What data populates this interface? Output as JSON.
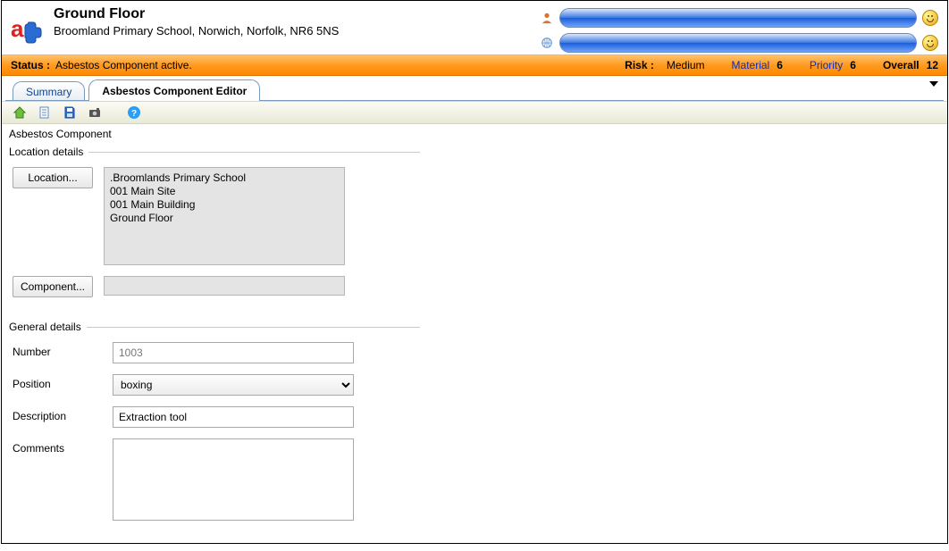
{
  "header": {
    "title": "Ground Floor",
    "subtitle": "Broomland Primary School, Norwich, Norfolk, NR6 5NS"
  },
  "status": {
    "label": "Status :",
    "text": "Asbestos Component active.",
    "risk_label": "Risk :",
    "risk_value": "Medium",
    "material_label": "Material",
    "material_value": "6",
    "priority_label": "Priority",
    "priority_value": "6",
    "overall_label": "Overall",
    "overall_value": "12"
  },
  "tabs": {
    "summary": "Summary",
    "editor": "Asbestos Component Editor"
  },
  "form": {
    "section_title": "Asbestos Component",
    "location_group": "Location details",
    "location_btn": "Location...",
    "location_text": ".Broomlands Primary School\n001 Main Site\n001 Main Building\nGround Floor",
    "component_btn": "Component...",
    "component_text": "",
    "general_group": "General details",
    "number_label": "Number",
    "number_value": "1003",
    "position_label": "Position",
    "position_value": "boxing",
    "description_label": "Description",
    "description_value": "Extraction tool",
    "comments_label": "Comments",
    "comments_value": ""
  }
}
